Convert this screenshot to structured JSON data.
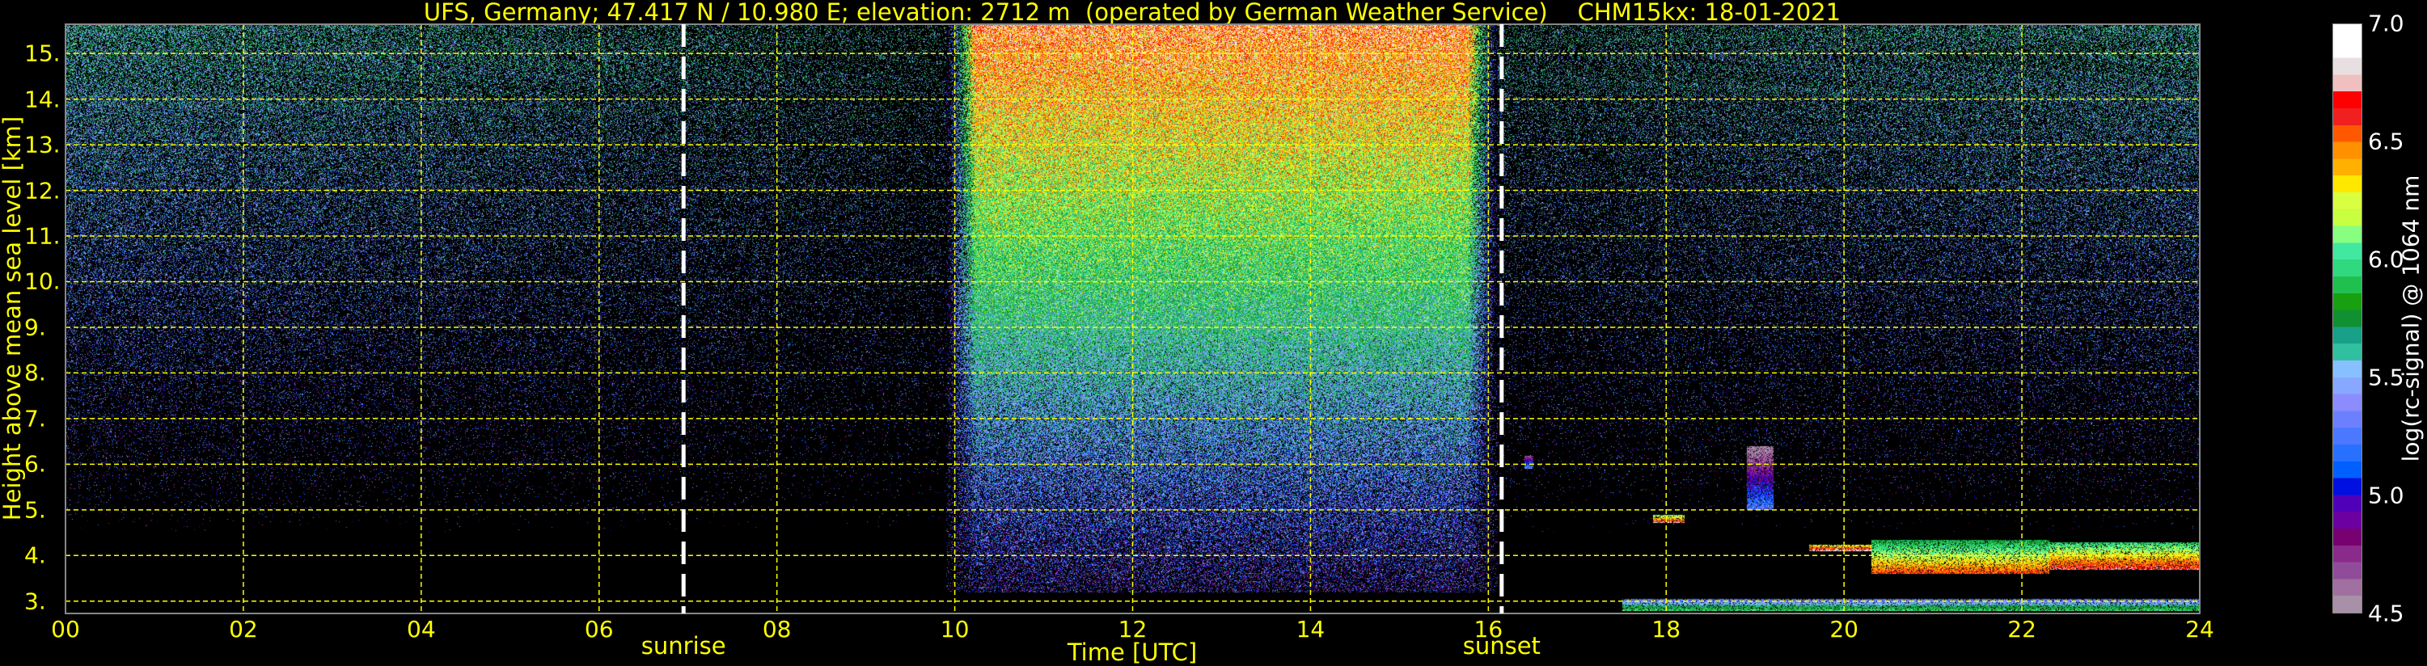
{
  "chart_data": {
    "type": "heatmap",
    "title": "UFS, Germany; 47.417 N / 10.980 E; elevation: 2712 m  (operated by German Weather Service)    CHM15kx: 18-01-2021",
    "xlabel": "Time [UTC]",
    "ylabel": "Height above mean sea level [km]",
    "xlim": [
      0,
      24
    ],
    "ylim": [
      2.73,
      15.64
    ],
    "x_ticks": [
      "00",
      "02",
      "04",
      "06",
      "08",
      "10",
      "12",
      "14",
      "16",
      "18",
      "20",
      "22",
      "24"
    ],
    "x_tick_values": [
      0,
      2,
      4,
      6,
      8,
      10,
      12,
      14,
      16,
      18,
      20,
      22,
      24
    ],
    "y_ticks": [
      "3.",
      "4.",
      "5.",
      "6.",
      "7.",
      "8.",
      "9.",
      "10.",
      "11.",
      "12.",
      "13.",
      "14.",
      "15."
    ],
    "y_tick_values": [
      3,
      4,
      5,
      6,
      7,
      8,
      9,
      10,
      11,
      12,
      13,
      14,
      15
    ],
    "grid": true,
    "events": [
      {
        "label": "sunrise",
        "time": 6.95
      },
      {
        "label": "sunset",
        "time": 16.15
      }
    ],
    "colorbar": {
      "label": "log(rc-signal) @ 1064 nm",
      "range": [
        4.5,
        7.0
      ],
      "ticks": [
        "4.5",
        "5.0",
        "5.5",
        "6.0",
        "6.5",
        "7.0"
      ],
      "tick_values": [
        4.5,
        5.0,
        5.5,
        6.0,
        6.5,
        7.0
      ],
      "colors": [
        "#a890a8",
        "#a070a0",
        "#904c98",
        "#8a2a8a",
        "#780070",
        "#6c00a0",
        "#5000b8",
        "#0010e0",
        "#0060ff",
        "#2870ff",
        "#4c78ff",
        "#6c80ff",
        "#8c8cff",
        "#88a8ff",
        "#88c0ff",
        "#30c0a0",
        "#18a088",
        "#109030",
        "#18a010",
        "#20c050",
        "#30d880",
        "#40e8a0",
        "#88ff80",
        "#c8ff40",
        "#d8ff40",
        "#ffe800",
        "#ffb000",
        "#ff9000",
        "#ff5800",
        "#f02020",
        "#ff0000",
        "#f0c0c0",
        "#e8e0e0",
        "#ffffff",
        "#ffffff"
      ]
    },
    "daytime_noise_window": [
      9.9,
      16.1
    ],
    "cloud_features": [
      {
        "t0": 17.85,
        "t1": 18.2,
        "h0": 4.72,
        "h1": 4.9,
        "value": 6.8
      },
      {
        "t0": 19.6,
        "t1": 20.3,
        "h0": 4.1,
        "h1": 4.25,
        "value": 6.9
      },
      {
        "t0": 20.3,
        "t1": 22.3,
        "h0": 3.6,
        "h1": 4.35,
        "value": 6.6
      },
      {
        "t0": 22.3,
        "t1": 24,
        "h0": 3.7,
        "h1": 4.3,
        "value": 6.7
      },
      {
        "t0": 17.5,
        "t1": 24,
        "h0": 2.8,
        "h1": 3.05,
        "value": 6.0
      },
      {
        "t0": 18.9,
        "t1": 19.2,
        "h0": 5.0,
        "h1": 6.4,
        "value": 5.3
      },
      {
        "t0": 16.4,
        "t1": 16.5,
        "h0": 5.9,
        "h1": 6.2,
        "value": 5.4
      }
    ]
  }
}
